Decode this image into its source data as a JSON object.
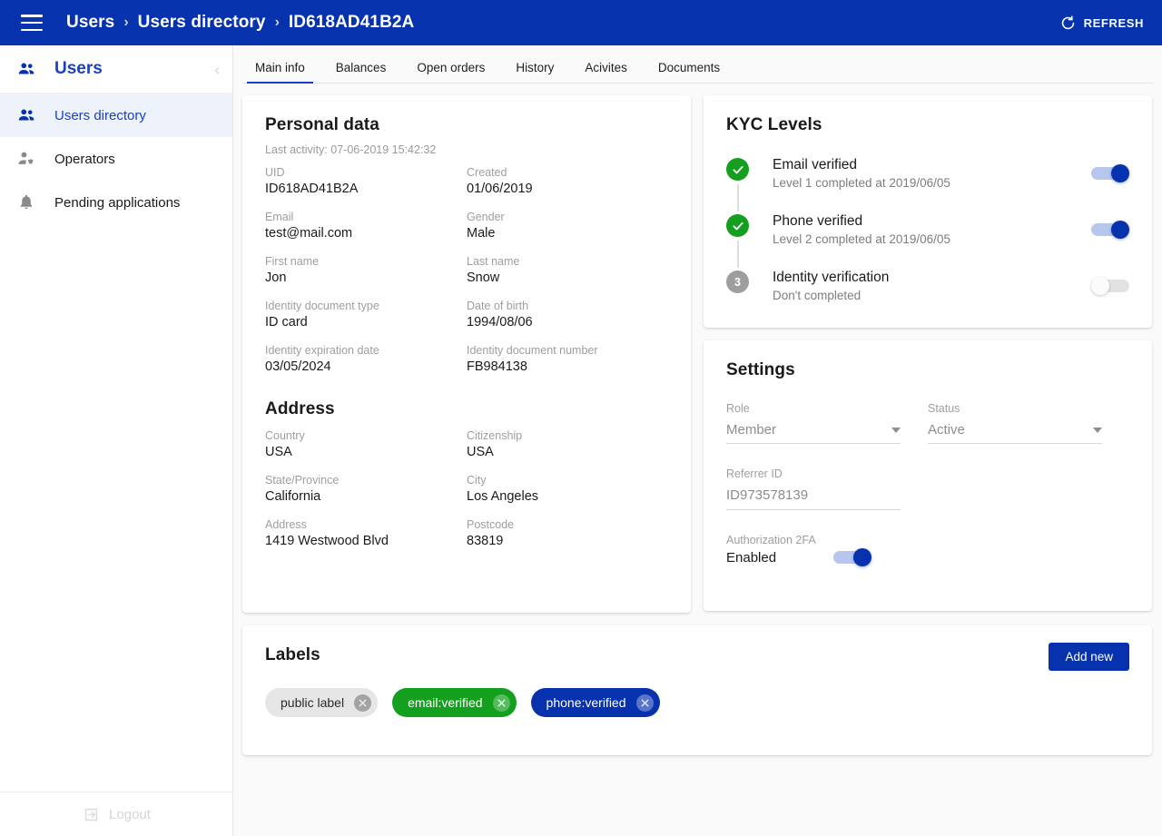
{
  "topbar": {
    "menu_icon": "hamburger-icon",
    "breadcrumbs": [
      "Users",
      "Users directory",
      "ID618AD41B2A"
    ],
    "separator": "›",
    "refresh_label": "REFRESH",
    "refresh_icon": "refresh-icon",
    "background": "#0633ad"
  },
  "sidebar": {
    "header": {
      "title": "Users",
      "icon": "people-icon",
      "collapse_icon": "chevron-left-icon"
    },
    "items": [
      {
        "label": "Users directory",
        "icon": "people-icon",
        "active": true
      },
      {
        "label": "Operators",
        "icon": "person-gear-icon",
        "active": false
      },
      {
        "label": "Pending applications",
        "icon": "bell-icon",
        "active": false
      }
    ],
    "logout": {
      "label": "Logout",
      "icon": "logout-icon"
    },
    "active_background": "#eef2fb",
    "accent": "#1a3fc4"
  },
  "tabs": [
    {
      "label": "Main info",
      "active": true
    },
    {
      "label": "Balances",
      "active": false
    },
    {
      "label": "Open orders",
      "active": false
    },
    {
      "label": "History",
      "active": false
    },
    {
      "label": "Acivites",
      "active": false
    },
    {
      "label": "Documents",
      "active": false
    }
  ],
  "personal_data": {
    "title": "Personal data",
    "last_activity": "Last activity: 07-06-2019 15:42:32",
    "fields": [
      {
        "label": "UID",
        "value": "ID618AD41B2A"
      },
      {
        "label": "Created",
        "value": "01/06/2019"
      },
      {
        "label": "Email",
        "value": "test@mail.com"
      },
      {
        "label": "Gender",
        "value": "Male"
      },
      {
        "label": "First name",
        "value": "Jon"
      },
      {
        "label": "Last name",
        "value": "Snow"
      },
      {
        "label": "Identity document type",
        "value": "ID card"
      },
      {
        "label": "Date of birth",
        "value": "1994/08/06"
      },
      {
        "label": "Identity expiration date",
        "value": "03/05/2024"
      },
      {
        "label": "Identity document number",
        "value": "FB984138"
      }
    ]
  },
  "address": {
    "title": "Address",
    "fields": [
      {
        "label": "Country",
        "value": "USA"
      },
      {
        "label": "Citizenship",
        "value": "USA"
      },
      {
        "label": "State/Province",
        "value": "California"
      },
      {
        "label": "City",
        "value": "Los Angeles"
      },
      {
        "label": "Address",
        "value": "1419 Westwood Blvd"
      },
      {
        "label": "Postcode",
        "value": "83819"
      }
    ]
  },
  "kyc": {
    "title": "KYC Levels",
    "levels": [
      {
        "badge": "check",
        "badge_text": "",
        "title": "Email verified",
        "subtitle": "Level 1 completed at 2019/06/05",
        "toggle": "on"
      },
      {
        "badge": "check",
        "badge_text": "",
        "title": "Phone verified",
        "subtitle": "Level 2 completed at 2019/06/05",
        "toggle": "on"
      },
      {
        "badge": "number",
        "badge_text": "3",
        "title": "Identity verification",
        "subtitle": "Don't completed",
        "toggle": "off"
      }
    ],
    "done_color": "#14a01e",
    "pending_color": "#9e9e9e"
  },
  "settings": {
    "title": "Settings",
    "role": {
      "label": "Role",
      "value": "Member"
    },
    "status": {
      "label": "Status",
      "value": "Active"
    },
    "referrer": {
      "label": "Referrer ID",
      "value": "ID973578139"
    },
    "two_fa": {
      "label": "Authorization 2FA",
      "value": "Enabled",
      "toggle": "on"
    }
  },
  "labels": {
    "title": "Labels",
    "add_button": "Add new",
    "chips": [
      {
        "text": "public label",
        "style": "grey"
      },
      {
        "text": "email:verified",
        "style": "green"
      },
      {
        "text": "phone:verified",
        "style": "blue"
      }
    ]
  }
}
